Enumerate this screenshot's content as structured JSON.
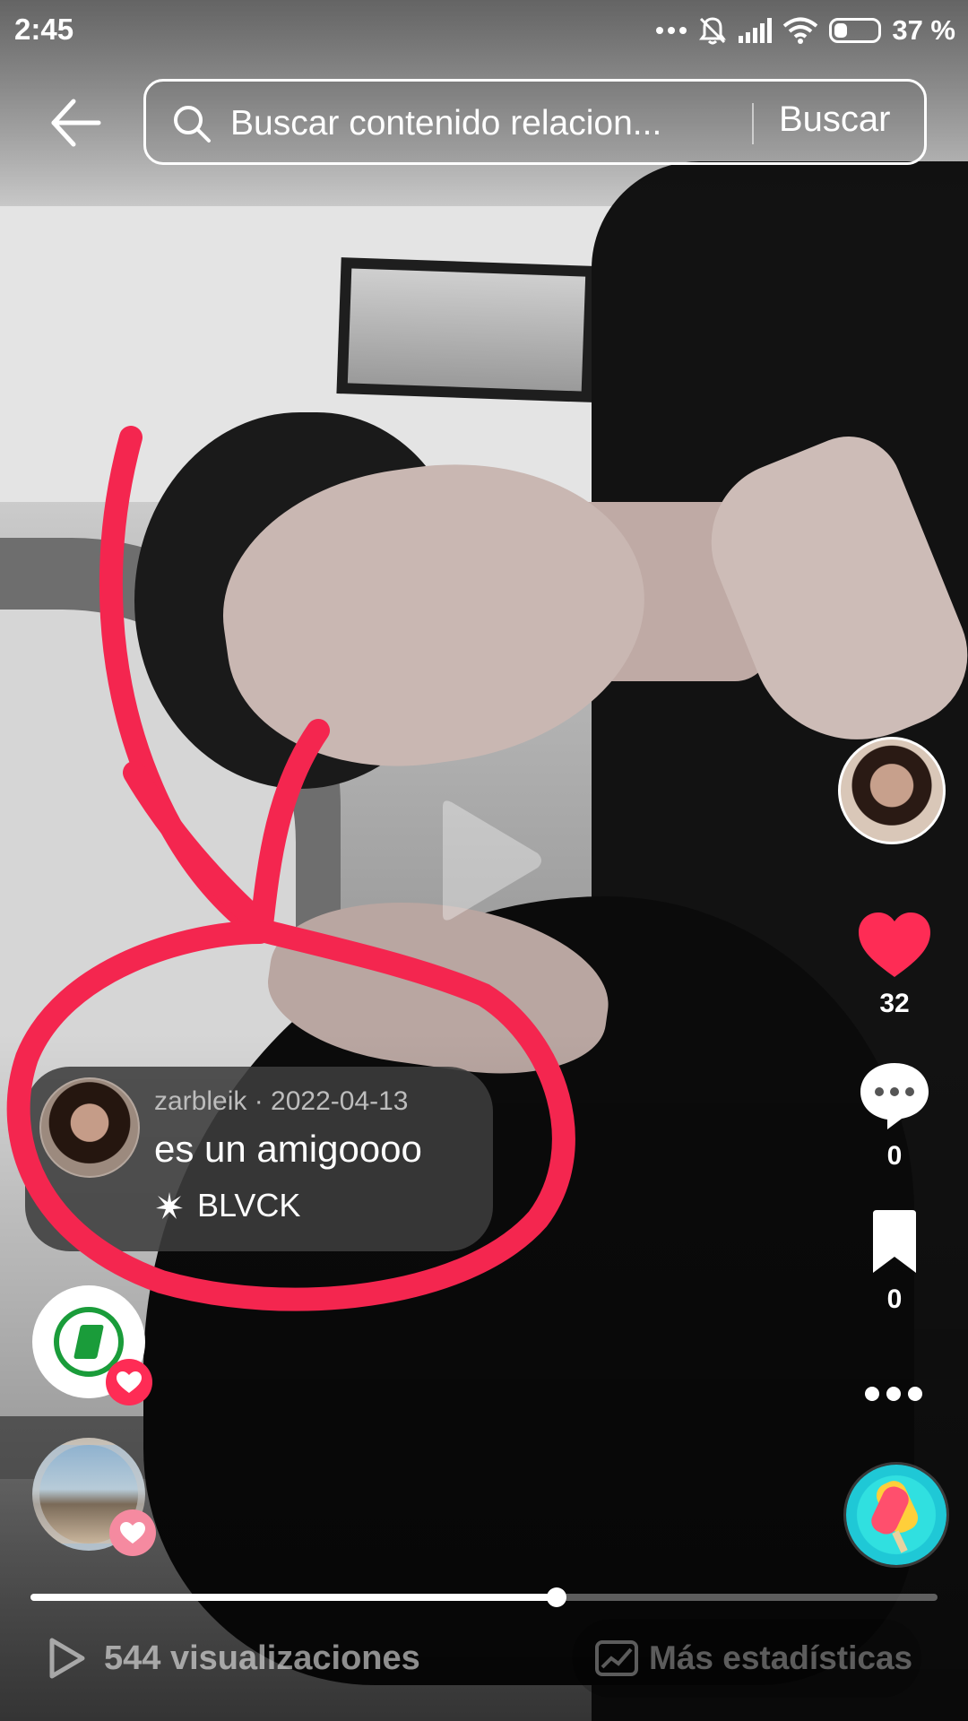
{
  "status_bar": {
    "time": "2:45",
    "battery_percent": "37 %",
    "battery_level": 0.37,
    "icons": [
      "more-dots-icon",
      "notifications-muted-icon",
      "signal-icon",
      "wifi-icon",
      "battery-icon"
    ]
  },
  "header": {
    "search_placeholder": "Buscar contenido relacion...",
    "search_button_label": "Buscar"
  },
  "actions": {
    "like_count": "32",
    "comment_count": "0",
    "save_count": "0"
  },
  "comment": {
    "meta": "zarbleik · 2022-04-13",
    "text": "es un amigoooo",
    "sound_label": "BLVCK"
  },
  "player": {
    "progress": 0.58,
    "views_label": "544 visualizaciones",
    "stats_label": "Más estadísticas"
  },
  "colors": {
    "accent": "#fe2c55",
    "annotation": "#f4264f"
  }
}
